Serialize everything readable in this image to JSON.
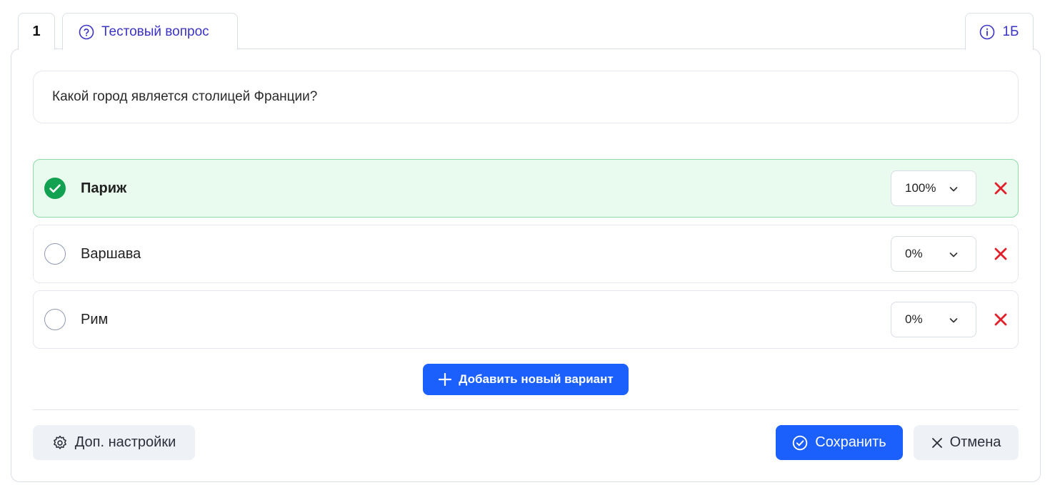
{
  "tabs": {
    "number": "1",
    "type_label": "Тестовый вопрос",
    "points": "1Б"
  },
  "question": {
    "text": "Какой город является столицей Франции?"
  },
  "answers": [
    {
      "text": "Париж",
      "percent": "100%",
      "correct": true
    },
    {
      "text": "Варшава",
      "percent": "0%",
      "correct": false
    },
    {
      "text": "Рим",
      "percent": "0%",
      "correct": false
    }
  ],
  "actions": {
    "add_variant": "Добавить новый вариант",
    "settings": "Доп. настройки",
    "save": "Сохранить",
    "cancel": "Отмена"
  },
  "icons": {
    "tab_type": "question-circle-icon",
    "tab_points": "info-circle-icon",
    "correct": "check-circle-icon",
    "remove": "close-icon",
    "dropdown": "chevron-down-icon",
    "add": "plus-icon",
    "settings": "gear-icon",
    "save": "check-circle-outline-icon",
    "cancel": "close-icon"
  },
  "colors": {
    "accent": "#1b5ffc",
    "tab_text": "#3b33c4",
    "correct_bg": "#e8fbee",
    "correct_check": "#12a150",
    "remove": "#e0202a"
  }
}
